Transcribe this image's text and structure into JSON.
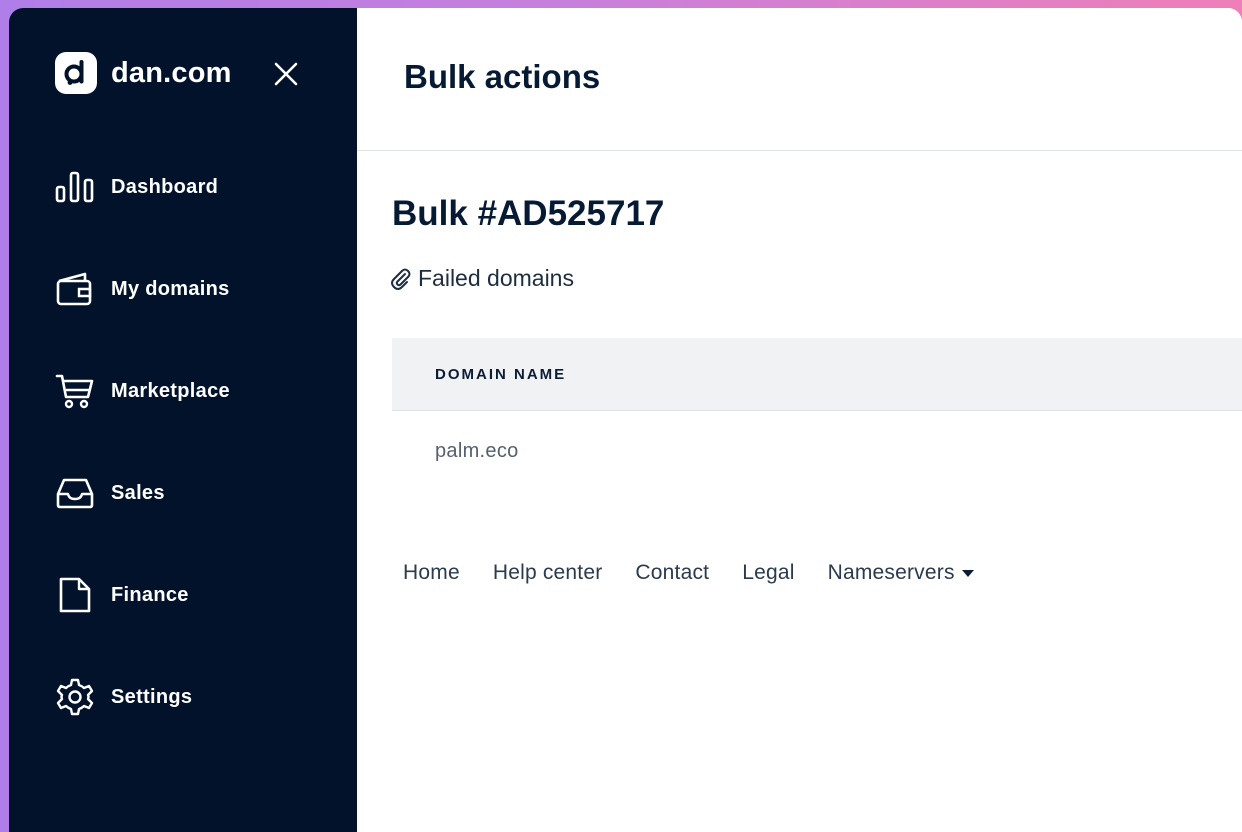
{
  "brand": {
    "name": "dan.com",
    "logo_icon": "dan-logo-icon",
    "close_icon": "close-icon"
  },
  "sidebar": {
    "items": [
      {
        "label": "Dashboard",
        "icon": "bar-chart-icon"
      },
      {
        "label": "My domains",
        "icon": "wallet-icon"
      },
      {
        "label": "Marketplace",
        "icon": "cart-icon"
      },
      {
        "label": "Sales",
        "icon": "inbox-icon"
      },
      {
        "label": "Finance",
        "icon": "document-icon"
      },
      {
        "label": "Settings",
        "icon": "gear-icon"
      }
    ]
  },
  "header": {
    "title": "Bulk actions"
  },
  "main": {
    "bulk_title": "Bulk #AD525717",
    "failed_link": "Failed domains",
    "failed_icon": "paperclip-icon",
    "table": {
      "columns": [
        "DOMAIN NAME"
      ],
      "rows": [
        [
          "palm.eco"
        ]
      ]
    }
  },
  "footer": {
    "links": [
      "Home",
      "Help center",
      "Contact",
      "Legal"
    ],
    "dropdown": "Nameservers",
    "dropdown_icon": "caret-down-icon"
  },
  "colors": {
    "sidebar_bg": "#02122b",
    "title_text": "#071a33",
    "table_header_bg": "#f1f2f4",
    "frame_gradient_start": "#b07ee8",
    "frame_gradient_end": "#ef7fb8"
  }
}
